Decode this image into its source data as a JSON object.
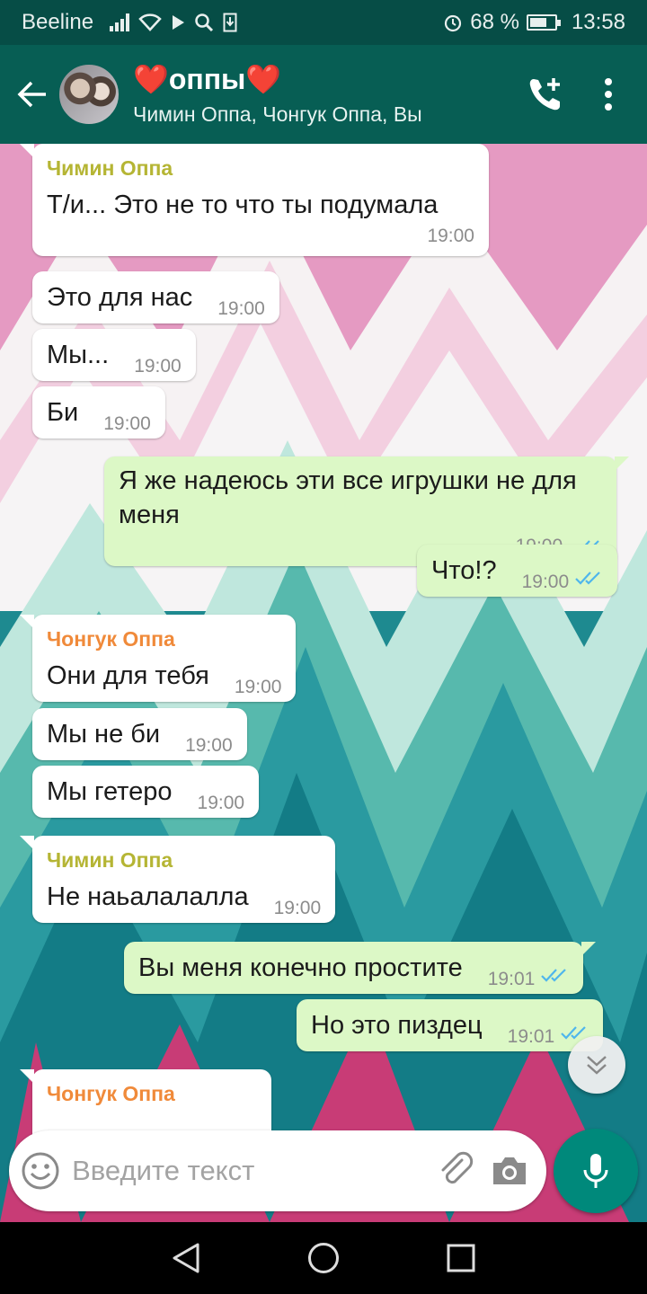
{
  "status": {
    "carrier": "Beeline",
    "battery": "68 %",
    "battery_level": 0.68,
    "time": "13:58"
  },
  "header": {
    "title": "❤️оппы❤️",
    "subtitle": "Чимин Оппа, Чонгук Оппа, Вы"
  },
  "colors": {
    "header": "#075e54",
    "statusbar": "#064d46",
    "sender_jimin": "#b5b534",
    "sender_jungkook": "#f08a3a",
    "tick": "#4fb6ec",
    "accent": "#00897b"
  },
  "messages": [
    {
      "sender": "Чимин Оппа",
      "text": "Т/и... Это не то что ты подумала",
      "time": "19:00"
    },
    {
      "text": "Это для нас",
      "time": "19:00"
    },
    {
      "text": "Мы...",
      "time": "19:00"
    },
    {
      "text": "Би",
      "time": "19:00"
    },
    {
      "text": "Я же надеюсь эти все игрушки не для меня",
      "time": "19:00"
    },
    {
      "text": "Что!?",
      "time": "19:00"
    },
    {
      "sender": "Чонгук Оппа",
      "text": "Они для тебя",
      "time": "19:00"
    },
    {
      "text": "Мы не би",
      "time": "19:00"
    },
    {
      "text": "Мы гетеро",
      "time": "19:00"
    },
    {
      "sender": "Чимин Оппа",
      "text": "Не наьалалалла",
      "time": "19:00"
    },
    {
      "text": "Вы меня конечно простите",
      "time": "19:01"
    },
    {
      "text": "Но это пиздец",
      "time": "19:01"
    },
    {
      "sender": "Чонгук Оппа"
    }
  ],
  "input": {
    "placeholder": "Введите текст"
  },
  "icons": {
    "back": "arrow-left-icon",
    "call": "add-call-icon",
    "menu": "more-vert-icon",
    "emoji": "emoji-icon",
    "attach": "paperclip-icon",
    "camera": "camera-icon",
    "mic": "mic-icon",
    "scroll": "chevron-double-down-icon"
  }
}
